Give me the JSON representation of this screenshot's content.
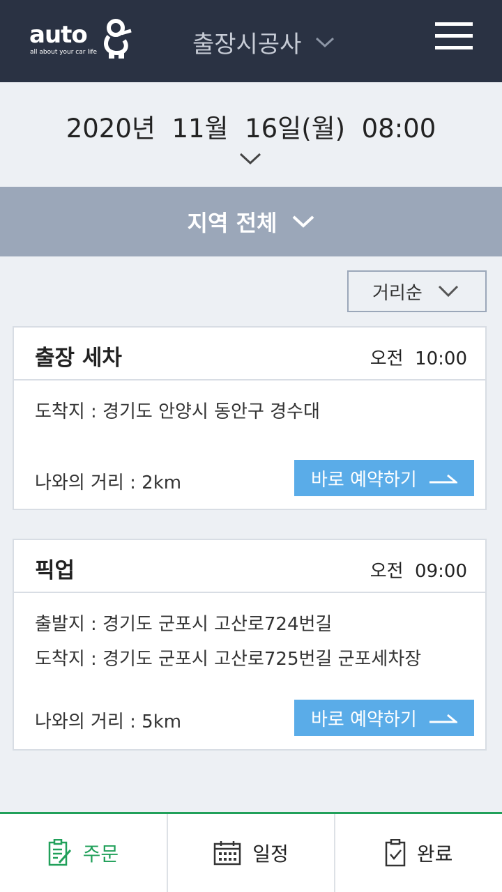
{
  "header": {
    "logo_text": "auto",
    "logo_tagline": "all about your car life",
    "title": "출장시공사"
  },
  "datebar": {
    "date": "2020년  11월  16일(월)  08:00"
  },
  "region": {
    "label": "지역 전체"
  },
  "sort": {
    "label": "거리순"
  },
  "cards": [
    {
      "title": "출장 세차",
      "time": "오전  10:00",
      "lines": [
        "도착지 : 경기도 안양시 동안구 경수대"
      ],
      "distance": "나와의 거리 : 2km",
      "button": "바로 예약하기"
    },
    {
      "title": "픽업",
      "time": "오전  09:00",
      "lines": [
        "출발지 : 경기도 군포시 고산로724번길",
        "도착지 : 경기도 군포시 고산로725번길 군포세차장"
      ],
      "distance": "나와의 거리 : 5km",
      "button": "바로 예약하기"
    }
  ],
  "tabs": [
    {
      "label": "주문",
      "icon": "order-icon",
      "active": true
    },
    {
      "label": "일정",
      "icon": "calendar-icon",
      "active": false
    },
    {
      "label": "완료",
      "icon": "clipboard-check-icon",
      "active": false
    }
  ],
  "colors": {
    "header": "#2a3243",
    "region": "#9ba7b9",
    "button": "#5aace8",
    "accent": "#21a05a",
    "background": "#edf0f4"
  }
}
